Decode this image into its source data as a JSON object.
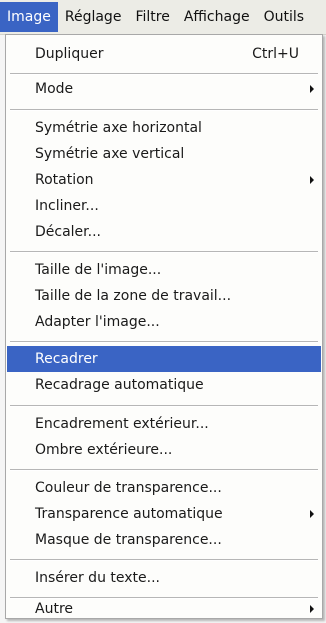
{
  "menubar": {
    "items": [
      {
        "label": "Image"
      },
      {
        "label": "Réglage"
      },
      {
        "label": "Filtre"
      },
      {
        "label": "Affichage"
      },
      {
        "label": "Outils"
      }
    ]
  },
  "menu": {
    "duplicate": {
      "label": "Dupliquer",
      "shortcut": "Ctrl+U"
    },
    "mode": {
      "label": "Mode",
      "has_submenu": true
    },
    "flip_horizontal": {
      "label": "Symétrie axe horizontal"
    },
    "flip_vertical": {
      "label": "Symétrie axe vertical"
    },
    "rotation": {
      "label": "Rotation",
      "has_submenu": true
    },
    "skew": {
      "label": "Incliner..."
    },
    "offset": {
      "label": "Décaler..."
    },
    "image_size": {
      "label": "Taille de l'image..."
    },
    "canvas_size": {
      "label": "Taille de la zone de travail..."
    },
    "fit_image": {
      "label": "Adapter l'image..."
    },
    "crop": {
      "label": "Recadrer",
      "highlighted": true
    },
    "autocrop": {
      "label": "Recadrage automatique"
    },
    "outer_frame": {
      "label": "Encadrement extérieur..."
    },
    "drop_shadow": {
      "label": "Ombre extérieure..."
    },
    "transparency_color": {
      "label": "Couleur de transparence..."
    },
    "auto_transparency": {
      "label": "Transparence automatique",
      "has_submenu": true
    },
    "transparency_mask": {
      "label": "Masque de transparence..."
    },
    "insert_text": {
      "label": "Insérer du texte..."
    },
    "other": {
      "label": "Autre",
      "has_submenu": true
    }
  },
  "colors": {
    "highlight": "#3a64c4",
    "menu_bg": "#fdfdfb",
    "menubar_bg": "#ecece6"
  }
}
